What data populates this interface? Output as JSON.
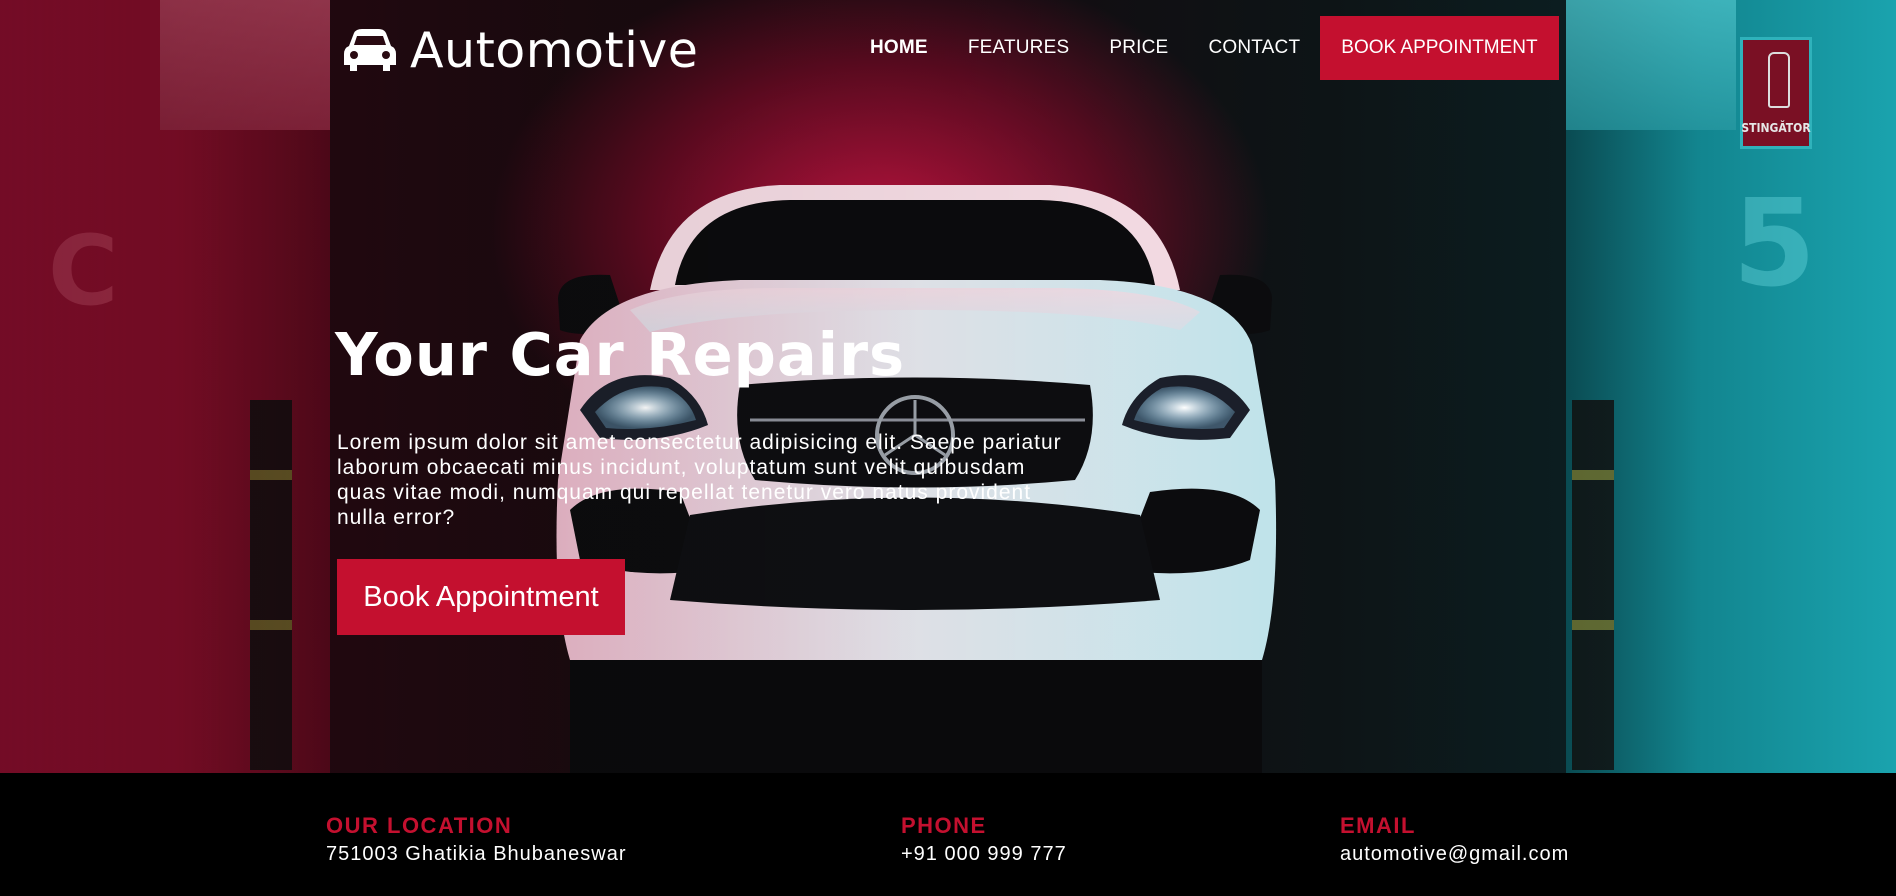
{
  "brand": {
    "name": "Automotive",
    "icon": "car-icon"
  },
  "nav": {
    "items": [
      {
        "label": "HOME",
        "active": true
      },
      {
        "label": "FEATURES",
        "active": false
      },
      {
        "label": "PRICE",
        "active": false
      },
      {
        "label": "CONTACT",
        "active": false
      }
    ],
    "cta_label": "BOOK APPOINTMENT"
  },
  "hero": {
    "title": "Your Car Repairs",
    "description": "Lorem ipsum dolor sit amet consectetur adipisicing elit. Saepe pariatur laborum obcaecati minus incidunt, voluptatum sunt velit quibusdam quas vitae modi, numquam qui repellat tenetur vero natus provident nulla error?",
    "button_label": "Book Appointment",
    "background": {
      "left_pillar_number": "C",
      "right_pillar_number": "5",
      "sign_text": "STINGĂTOR"
    }
  },
  "info": {
    "location": {
      "title": "OUR LOCATION",
      "value": "751003 Ghatikia Bhubaneswar"
    },
    "phone": {
      "title": "PHONE",
      "value": "+91 000 999 777"
    },
    "email": {
      "title": "EMAIL",
      "value": "automotive@gmail.com"
    }
  },
  "colors": {
    "accent": "#c4102f",
    "footer_bg": "#000000",
    "text": "#ffffff"
  }
}
